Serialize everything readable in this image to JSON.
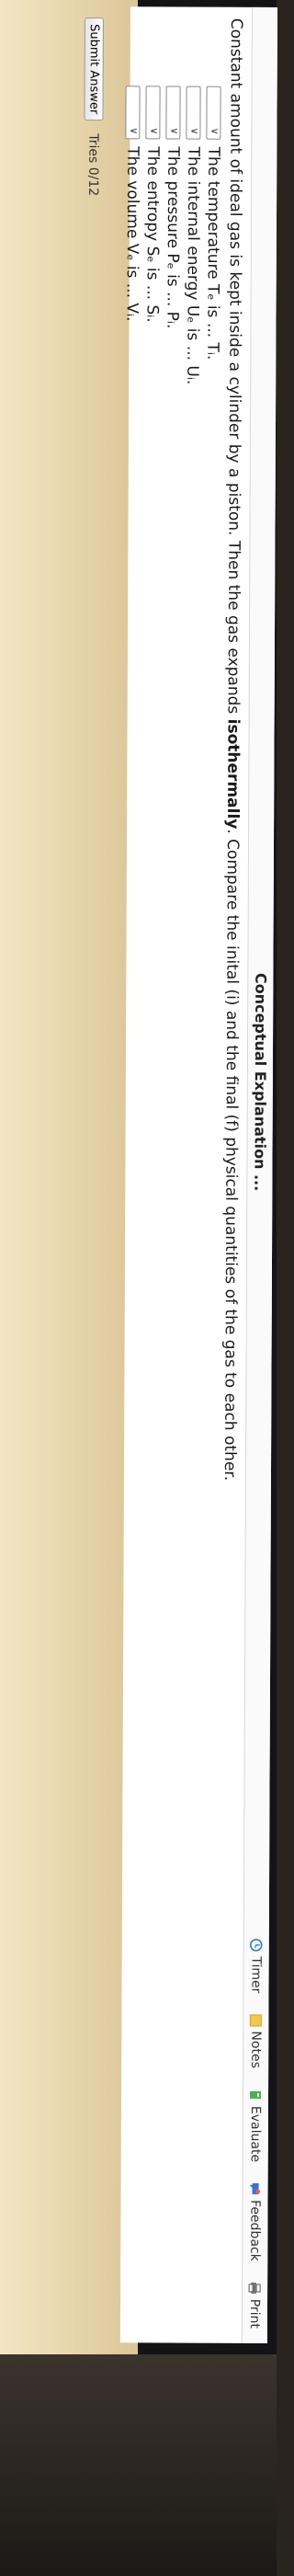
{
  "toolbar": {
    "section_title": "Conceptual Explanation ...",
    "items": [
      {
        "label": "Timer",
        "icon": "timer-icon",
        "color": "#2f74c0"
      },
      {
        "label": "Notes",
        "icon": "notes-icon",
        "color": "#f2c94c"
      },
      {
        "label": "Evaluate",
        "icon": "evaluate-icon",
        "color": "#4caf50"
      },
      {
        "label": "Feedback",
        "icon": "feedback-icon",
        "color": "#3f6fd1"
      },
      {
        "label": "Print",
        "icon": "print-icon",
        "color": "#555555"
      }
    ]
  },
  "question": {
    "prefix": "Constant amount of ideal gas is kept inside a cylinder by a piston. Then the gas expands ",
    "emphasis": "isothermally",
    "suffix": ". Compare the inital (i) and the final (f) physical quantities of the gas to each other."
  },
  "items": [
    {
      "text": "The temperature Tₑ is ... Tᵢ."
    },
    {
      "text": "The internal energy Uₑ is ... Uᵢ."
    },
    {
      "text": "The pressure Pₑ is ... Pᵢ."
    },
    {
      "text": "The entropy Sₑ is ... Sᵢ."
    },
    {
      "text": "The volume Vₑ is ... Vᵢ."
    }
  ],
  "footer": {
    "submit_label": "Submit Answer",
    "tries": "Tries 0/12"
  }
}
